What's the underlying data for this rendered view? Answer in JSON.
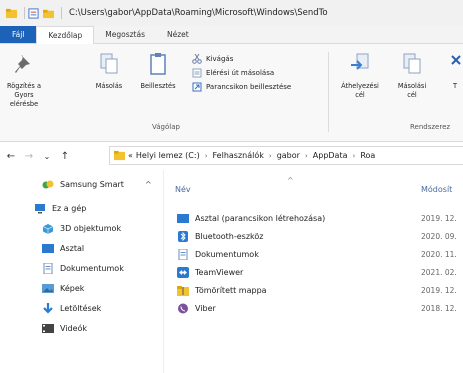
{
  "window": {
    "path": "C:\\Users\\gabor\\AppData\\Roaming\\Microsoft\\Windows\\SendTo"
  },
  "tabs": [
    {
      "label": "Fájl"
    },
    {
      "label": "Kezdőlap"
    },
    {
      "label": "Megosztás"
    },
    {
      "label": "Nézet"
    }
  ],
  "ribbon": {
    "pin_label": "Rögzítés a Gyors elérésbe",
    "copy_label": "Másolás",
    "paste_label": "Beillesztés",
    "cut_label": "Kivágás",
    "copy_path_label": "Elérési út másolása",
    "paste_shortcut_label": "Parancsikon beillesztése",
    "clipboard_group": "Vágólap",
    "move_to_label": "Áthelyezési cél",
    "copy_to_label": "Másolási cél",
    "delete_partial": "T",
    "organize_group": "Rendszerez"
  },
  "nav": {
    "back": "←",
    "forward": "→",
    "recent": "⌄",
    "up": "↑",
    "crumb_prefix": "«",
    "crumbs": [
      "Helyi lemez (C:)",
      "Felhasználók",
      "gabor",
      "AppData",
      "Roa"
    ],
    "separator": "›"
  },
  "sidebar": {
    "items": [
      {
        "label": "Samsung Smart",
        "icon": "cloud-icon"
      },
      {
        "label": "Ez a gép",
        "icon": "computer-icon"
      },
      {
        "label": "3D objektumok",
        "icon": "cube-icon"
      },
      {
        "label": "Asztal",
        "icon": "desktop-icon"
      },
      {
        "label": "Dokumentumok",
        "icon": "document-icon"
      },
      {
        "label": "Képek",
        "icon": "picture-icon"
      },
      {
        "label": "Letöltések",
        "icon": "download-icon"
      },
      {
        "label": "Videók",
        "icon": "video-icon"
      }
    ],
    "collapse_symbol": "^"
  },
  "content": {
    "columns": {
      "name": "Név",
      "modified": "Módosít",
      "sort_symbol": "^"
    },
    "rows": [
      {
        "name": "Asztal (parancsikon létrehozása)",
        "date": "2019. 12.",
        "icon": "desktop-icon"
      },
      {
        "name": "Bluetooth-eszköz",
        "date": "2020. 09.",
        "icon": "bluetooth-icon"
      },
      {
        "name": "Dokumentumok",
        "date": "2020. 11.",
        "icon": "document-icon"
      },
      {
        "name": "TeamViewer",
        "date": "2021. 02.",
        "icon": "teamviewer-icon"
      },
      {
        "name": "Tömörített mappa",
        "date": "2019. 12.",
        "icon": "zip-folder-icon"
      },
      {
        "name": "Viber",
        "date": "2018. 12.",
        "icon": "viber-icon"
      }
    ]
  },
  "colors": {
    "file_tab": "#1c62b9",
    "folder_yellow": "#f2c230",
    "accent_blue": "#2a7ad1"
  }
}
